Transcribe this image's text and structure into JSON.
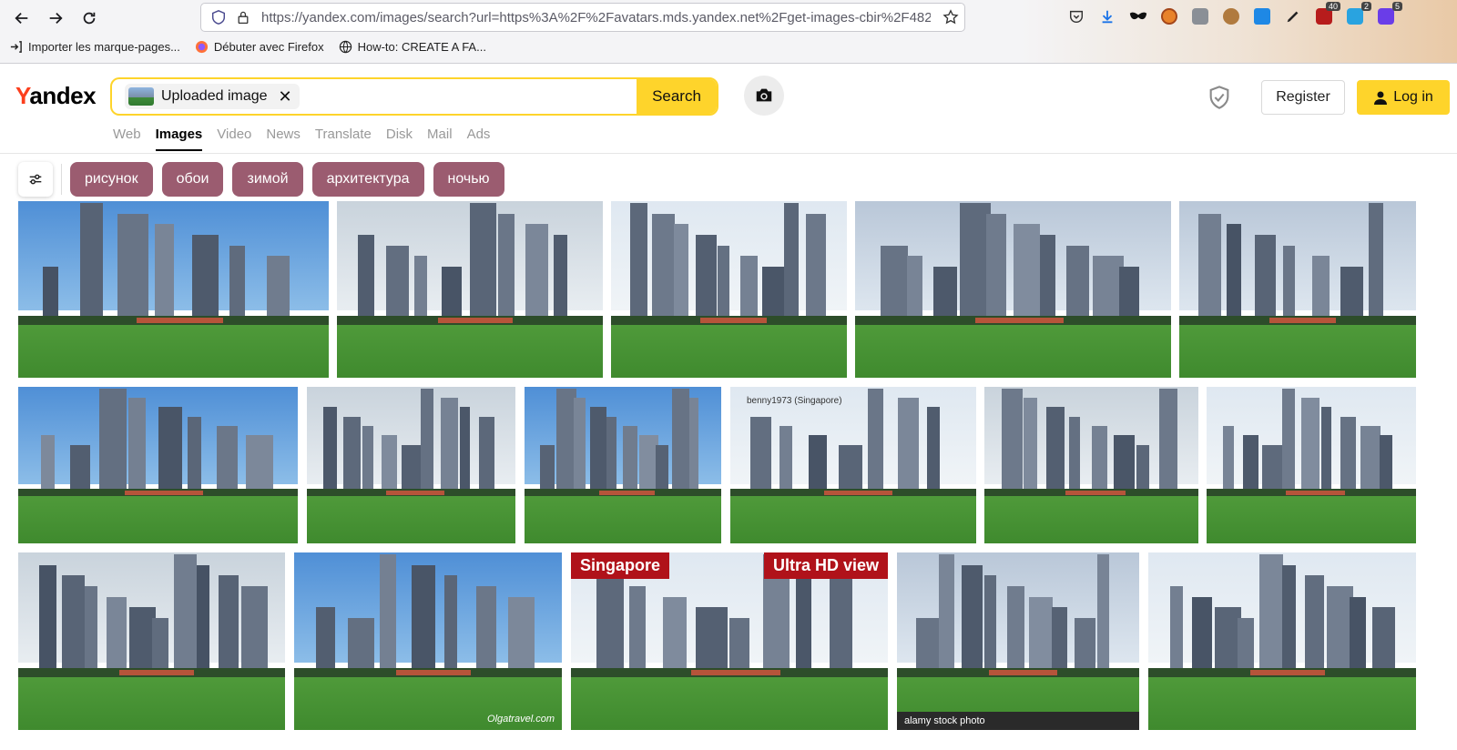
{
  "browser": {
    "url": "https://yandex.com/images/search?url=https%3A%2F%2Favatars.mds.yandex.net%2Fget-images-cbir%2F4821638",
    "bookmarks": [
      {
        "label": "Importer les marque-pages..."
      },
      {
        "label": "Débuter avec Firefox"
      },
      {
        "label": "How-to: CREATE A FA..."
      }
    ],
    "extension_badges": {
      "ublock": "40",
      "ext2": "2",
      "ext3": "5"
    }
  },
  "header": {
    "logo_first": "Y",
    "logo_rest": "andex",
    "chip_label": "Uploaded image",
    "chip_close": "✕",
    "search_label": "Search",
    "register_label": "Register",
    "login_label": "Log in"
  },
  "tabs": [
    {
      "label": "Web"
    },
    {
      "label": "Images"
    },
    {
      "label": "Video"
    },
    {
      "label": "News"
    },
    {
      "label": "Translate"
    },
    {
      "label": "Disk"
    },
    {
      "label": "Mail"
    },
    {
      "label": "Ads"
    }
  ],
  "filters": [
    {
      "label": "рисунок"
    },
    {
      "label": "обои"
    },
    {
      "label": "зимой"
    },
    {
      "label": "архитектура"
    },
    {
      "label": "ночью"
    }
  ],
  "images": {
    "overlay_left": "Singapore",
    "overlay_right": "Ultra HD view",
    "credit_benny": "benny1973 (Singapore)",
    "credit_alamy": "alamy stock photo",
    "credit_olga": "Olgatravel.com"
  },
  "colors": {
    "accent": "#fed42b",
    "chip": "#9b5c70",
    "logo_red": "#fc3f1d"
  }
}
